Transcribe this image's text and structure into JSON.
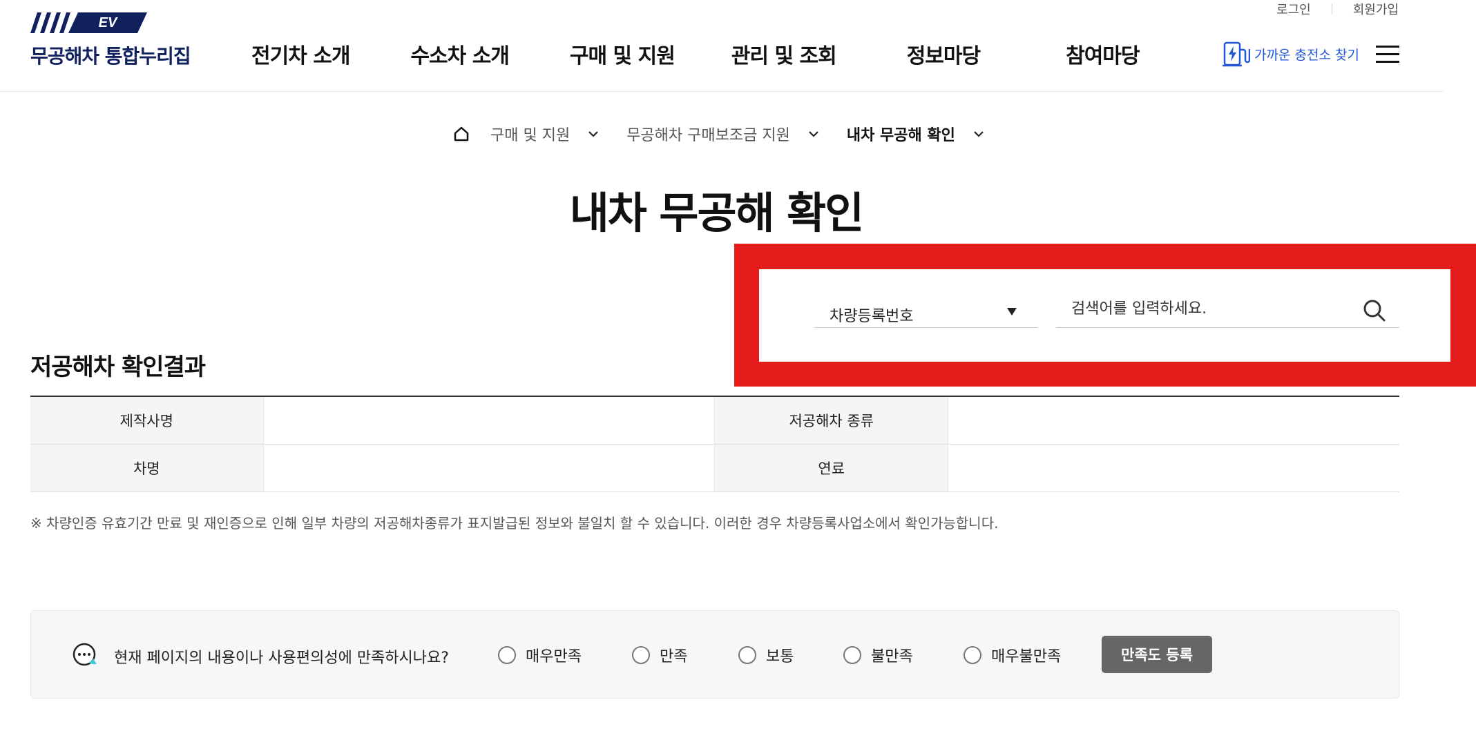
{
  "header": {
    "logo_badge": "EV",
    "logo_text": "무공해차 통합누리집",
    "util_links": {
      "login": "로그인",
      "signup": "회원가입"
    },
    "nav": [
      "전기차 소개",
      "수소차 소개",
      "구매 및 지원",
      "관리 및 조회",
      "정보마당",
      "참여마당"
    ],
    "charger_link": "가까운 충전소 찾기"
  },
  "breadcrumb": [
    "구매 및 지원",
    "무공해차 구매보조금 지원",
    "내차 무공해 확인"
  ],
  "page_title": "내차 무공해 확인",
  "search": {
    "select_value": "차량등록번호",
    "placeholder": "검색어를 입력하세요.",
    "highlight_color": "#e61c1c"
  },
  "result": {
    "title": "저공해차 확인결과",
    "rows": [
      {
        "label1": "제작사명",
        "value1": "",
        "label2": "저공해차 종류",
        "value2": ""
      },
      {
        "label1": "차명",
        "value1": "",
        "label2": "연료",
        "value2": ""
      }
    ],
    "notice": "※ 차량인증 유효기간 만료 및 재인증으로 인해 일부 차량의 저공해차종류가 표지발급된 정보와 불일치 할 수 있습니다. 이러한 경우 차량등록사업소에서 확인가능합니다."
  },
  "survey": {
    "question": "현재 페이지의 내용이나 사용편의성에 만족하시나요?",
    "options": [
      "매우만족",
      "만족",
      "보통",
      "불만족",
      "매우불만족"
    ],
    "submit": "만족도 등록"
  },
  "colors": {
    "brand": "#10215e",
    "link": "#1f56d6",
    "button": "#666666"
  }
}
